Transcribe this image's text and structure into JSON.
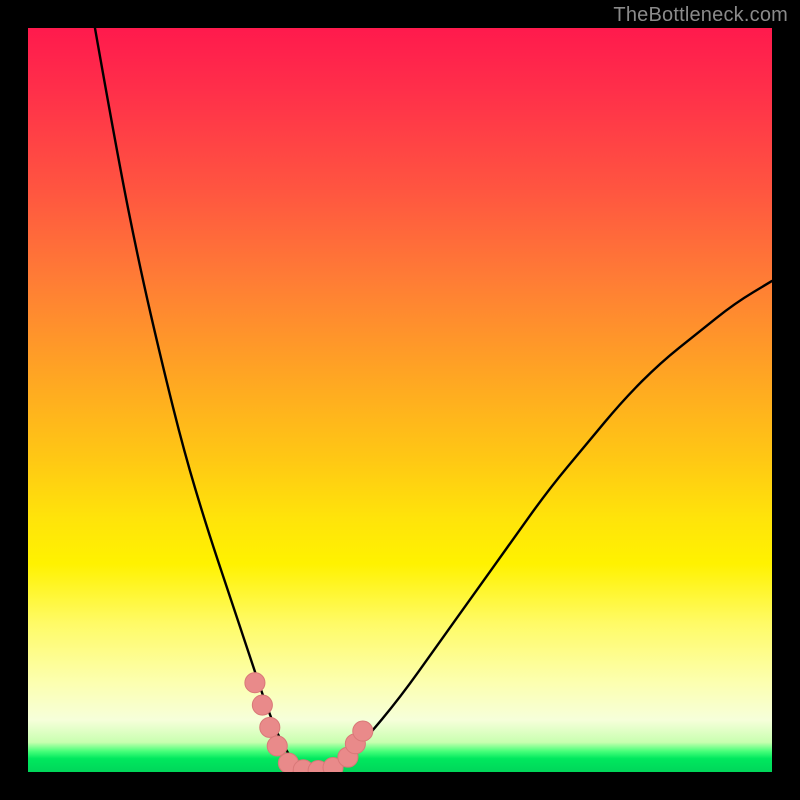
{
  "watermark": {
    "text": "TheBottleneck.com"
  },
  "colors": {
    "curve": "#000000",
    "marker": "#e98a8a",
    "marker_stroke": "#d97878"
  },
  "chart_data": {
    "type": "line",
    "title": "",
    "xlabel": "",
    "ylabel": "",
    "xlim": [
      0,
      100
    ],
    "ylim": [
      0,
      100
    ],
    "grid": false,
    "legend": false,
    "note": "V-shaped bottleneck curve. x is relative hardware balance position (0–100). y is bottleneck percentage (0–100, 0 = no bottleneck). Minimum plateau ~0 around x 34–42. Left branch enters top of chart near x≈9. Right branch exits right edge near y≈66.",
    "series": [
      {
        "name": "bottleneck-curve",
        "x": [
          9,
          12,
          15,
          18,
          21,
          24,
          27,
          30,
          32,
          34,
          36,
          38,
          40,
          42,
          45,
          50,
          55,
          60,
          65,
          70,
          75,
          80,
          85,
          90,
          95,
          100
        ],
        "y": [
          100,
          83,
          68,
          55,
          43,
          33,
          24,
          15,
          9,
          4,
          1,
          0,
          0,
          1,
          4,
          10,
          17,
          24,
          31,
          38,
          44,
          50,
          55,
          59,
          63,
          66
        ]
      }
    ],
    "markers": {
      "note": "Pink rounded markers clustered near the valley",
      "points": [
        {
          "x": 30.5,
          "y": 12
        },
        {
          "x": 31.5,
          "y": 9
        },
        {
          "x": 32.5,
          "y": 6
        },
        {
          "x": 33.5,
          "y": 3.5
        },
        {
          "x": 35.0,
          "y": 1.2
        },
        {
          "x": 37.0,
          "y": 0.3
        },
        {
          "x": 39.0,
          "y": 0.2
        },
        {
          "x": 41.0,
          "y": 0.6
        },
        {
          "x": 43.0,
          "y": 2.0
        },
        {
          "x": 44.0,
          "y": 3.8
        },
        {
          "x": 45.0,
          "y": 5.5
        }
      ],
      "radius_pct": 1.35
    }
  }
}
